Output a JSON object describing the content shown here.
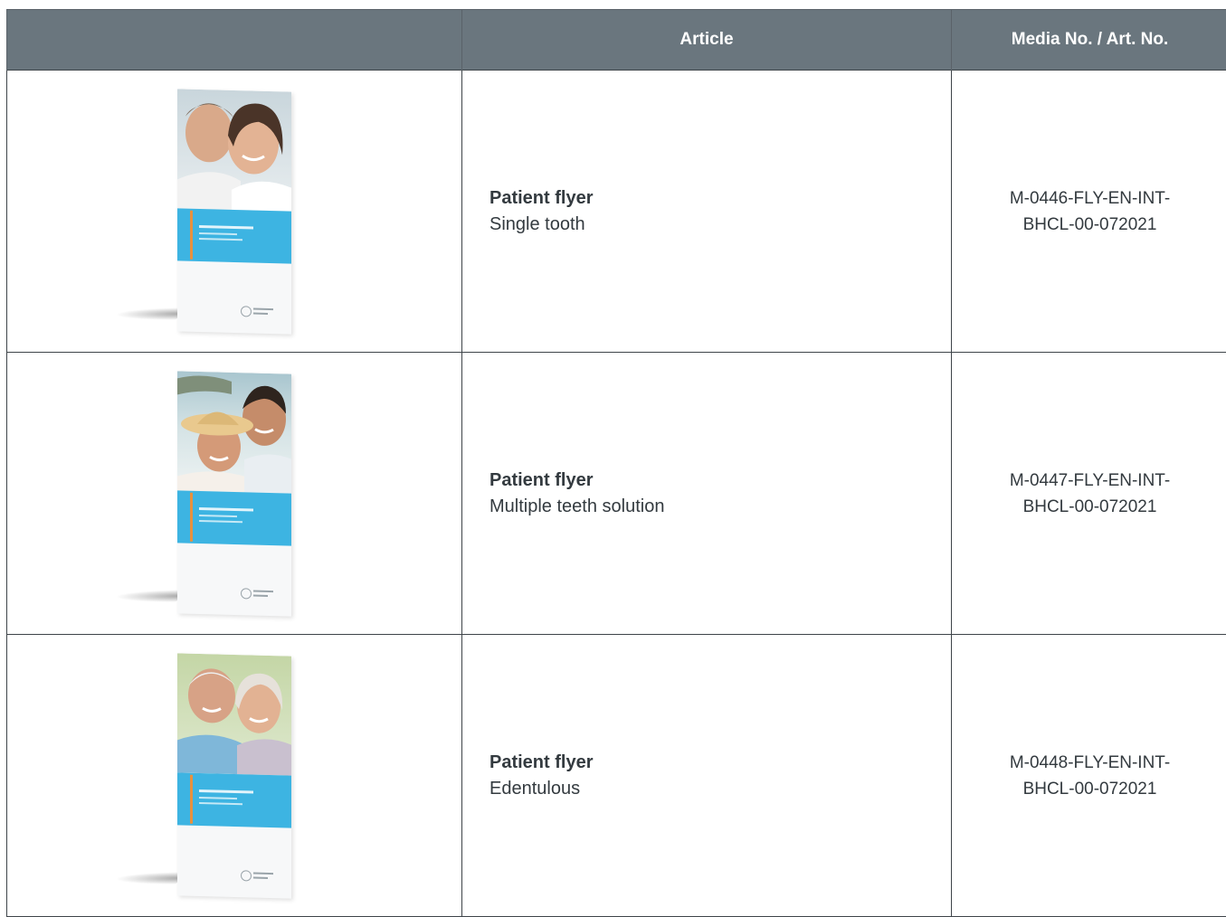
{
  "header": {
    "col_image": "",
    "col_article": "Article",
    "col_media": "Media No. / Art. No."
  },
  "rows": [
    {
      "image": "patient-flyer-single-tooth-image",
      "title": "Patient flyer",
      "subtitle": "Single tooth",
      "media_line1": "M-0446-FLY-EN-INT-",
      "media_line2": "BHCL-00-072021"
    },
    {
      "image": "patient-flyer-multiple-teeth-image",
      "title": "Patient flyer",
      "subtitle": "Multiple teeth solution",
      "media_line1": "M-0447-FLY-EN-INT-",
      "media_line2": "BHCL-00-072021"
    },
    {
      "image": "patient-flyer-edentulous-image",
      "title": "Patient flyer",
      "subtitle": "Edentulous",
      "media_line1": "M-0448-FLY-EN-INT-",
      "media_line2": "BHCL-00-072021"
    }
  ],
  "colors": {
    "header_bg": "#6a767e",
    "header_text": "#ffffff",
    "flyer_band": "#3db4e2",
    "flyer_accent": "#e8913e"
  }
}
